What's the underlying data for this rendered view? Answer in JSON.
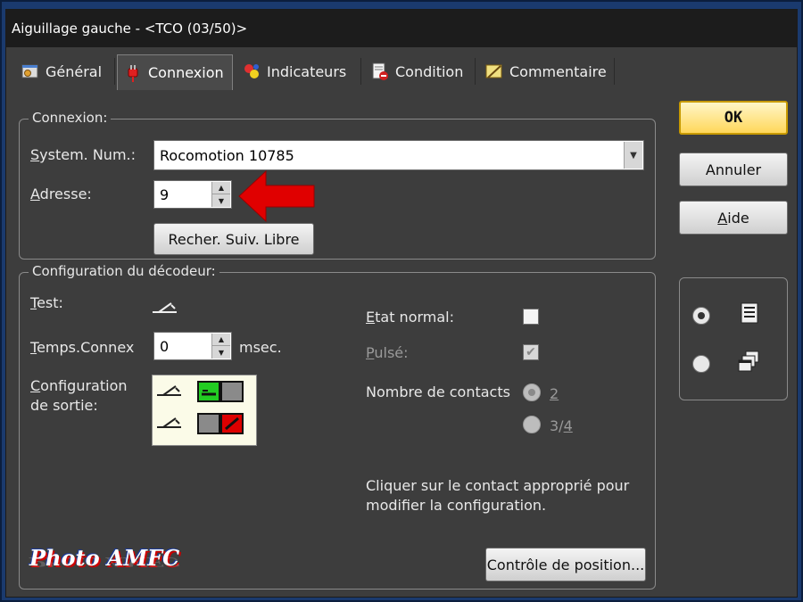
{
  "window": {
    "title": "Aiguillage gauche - <TCO (03/50)>"
  },
  "tabs": [
    {
      "label": "Général",
      "icon": "gear-window-icon",
      "active": false
    },
    {
      "label": "Connexion",
      "icon": "plug-icon",
      "active": true
    },
    {
      "label": "Indicateurs",
      "icon": "indicator-icon",
      "active": false
    },
    {
      "label": "Condition",
      "icon": "condition-icon",
      "active": false
    },
    {
      "label": "Commentaire",
      "icon": "comment-icon",
      "active": false
    }
  ],
  "connexion": {
    "legend": "Connexion:",
    "system_label_u": "S",
    "system_label_rest": "ystem. Num.:",
    "system_value": "Rocomotion 10785",
    "address_label_u": "A",
    "address_label_rest": "dresse:",
    "address_value": "9",
    "search_button": "Recher. Suiv. Libre"
  },
  "decoder": {
    "legend": "Configuration du décodeur:",
    "test_label_u": "T",
    "test_label_rest": "est:",
    "temps_label_u": "T",
    "temps_label_rest": "emps.Connex",
    "temps_value": "0",
    "temps_unit": "msec.",
    "config_label_u": "C",
    "config_label_rest1": "onfiguration",
    "config_label_line2": "de sortie:",
    "etat_label_u": "E",
    "etat_label_rest": "tat normal:",
    "etat_checked": false,
    "pulse_label_u": "P",
    "pulse_label_rest": "ulsé:",
    "pulse_checked": true,
    "contacts_label": "Nombre de contacts",
    "contacts_opt1": "2",
    "contacts_opt2_a": "3/",
    "contacts_opt2_u": "4",
    "hint_line1": "Cliquer sur le contact approprié pour",
    "hint_line2": "modifier la configuration.",
    "position_button": "Contrôle de position..."
  },
  "buttons": {
    "ok": "OK",
    "cancel": "Annuler",
    "help_u": "A",
    "help_rest": "ide"
  },
  "view_options": [
    {
      "icon": "list-icon",
      "selected": true
    },
    {
      "icon": "cascade-windows-icon",
      "selected": false
    }
  ],
  "watermark": "Photo AMFC",
  "colors": {
    "ok_fill": "#ffd75a",
    "arrow": "#e00000",
    "active_green": "#22cc22",
    "active_red": "#dd0000"
  }
}
